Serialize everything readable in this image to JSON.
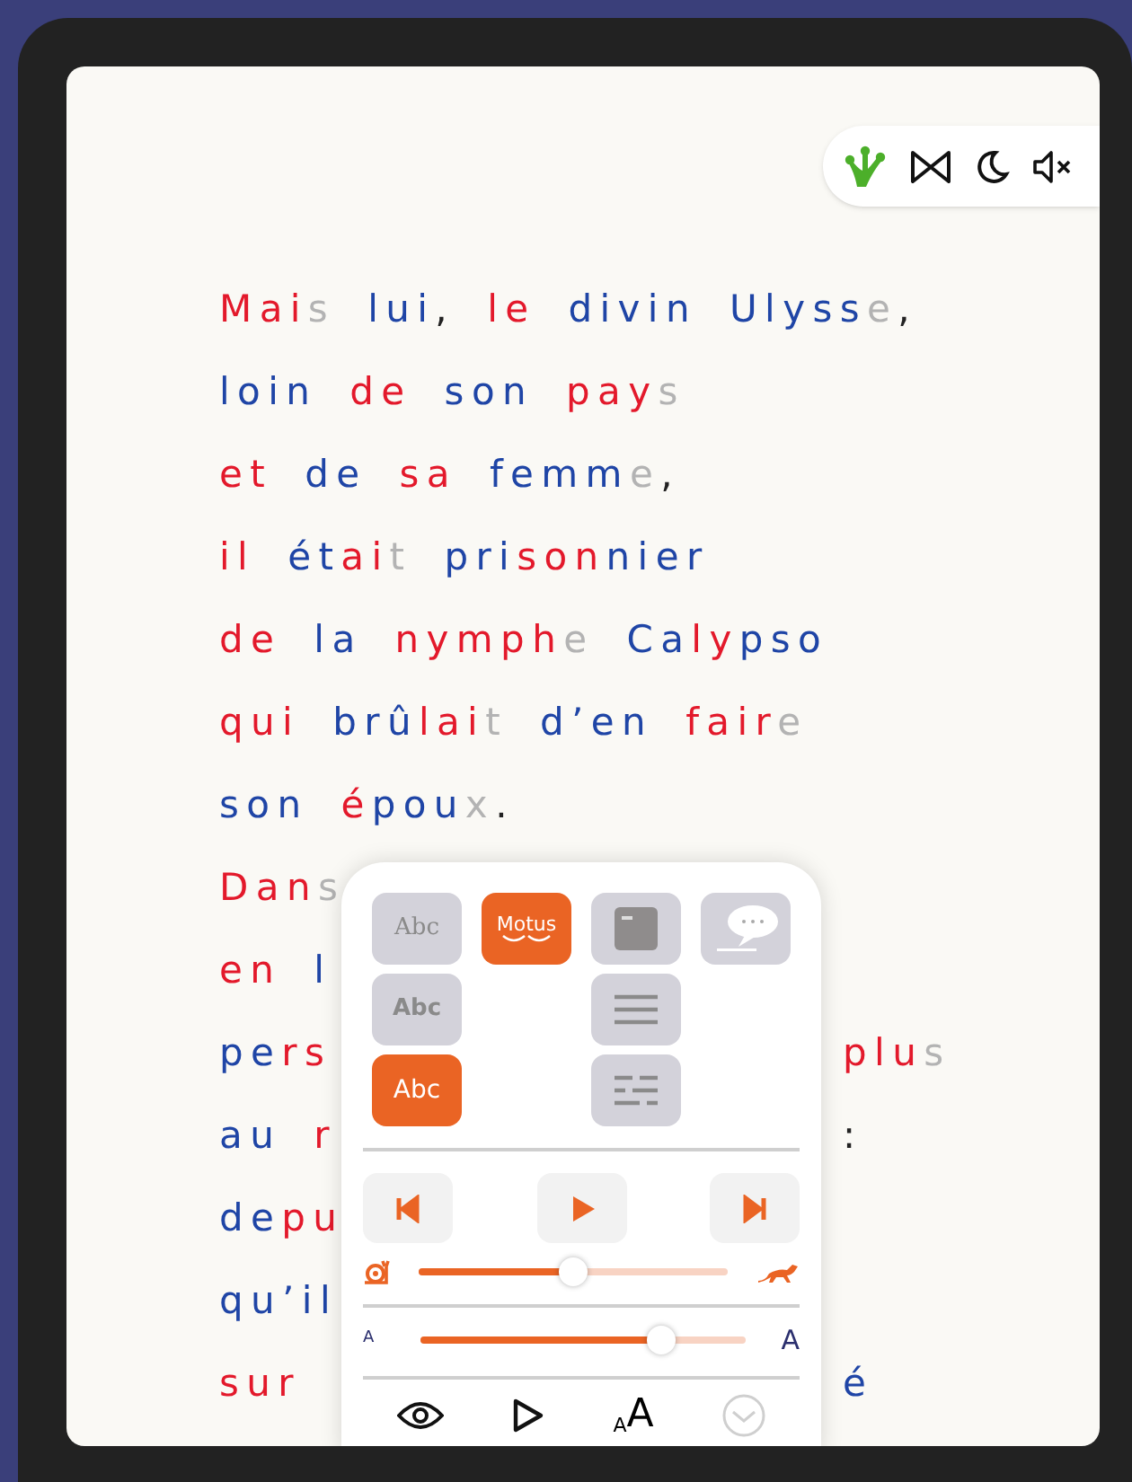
{
  "text_lines": [
    {
      "words": [
        [
          {
            "text": "Mai",
            "color": "#e3192b"
          },
          {
            "text": "s",
            "color": "#b3b3b3"
          }
        ],
        [
          {
            "text": "lui",
            "color": "#1f45a6"
          },
          {
            "text": ",",
            "color": "#222222"
          }
        ],
        [
          {
            "text": "le",
            "color": "#e3192b"
          }
        ],
        [
          {
            "text": "divin",
            "color": "#1f45a6"
          }
        ],
        [
          {
            "text": "Ulyss",
            "color": "#1f45a6"
          },
          {
            "text": "e",
            "color": "#b3b3b3"
          },
          {
            "text": ",",
            "color": "#222222"
          }
        ]
      ]
    },
    {
      "words": [
        [
          {
            "text": "loin",
            "color": "#1f45a6"
          }
        ],
        [
          {
            "text": "de",
            "color": "#e3192b"
          }
        ],
        [
          {
            "text": "son",
            "color": "#1f45a6"
          }
        ],
        [
          {
            "text": "pay",
            "color": "#e3192b"
          },
          {
            "text": "s",
            "color": "#b3b3b3"
          }
        ]
      ]
    },
    {
      "words": [
        [
          {
            "text": "et",
            "color": "#e3192b"
          }
        ],
        [
          {
            "text": "de",
            "color": "#1f45a6"
          }
        ],
        [
          {
            "text": "sa",
            "color": "#e3192b"
          }
        ],
        [
          {
            "text": "femm",
            "color": "#1f45a6"
          },
          {
            "text": "e",
            "color": "#b3b3b3"
          },
          {
            "text": ",",
            "color": "#222222"
          }
        ]
      ]
    },
    {
      "words": [
        [
          {
            "text": "il",
            "color": "#e3192b"
          }
        ],
        [
          {
            "text": "ét",
            "color": "#1f45a6"
          },
          {
            "text": "ai",
            "color": "#e3192b"
          },
          {
            "text": "t",
            "color": "#b3b3b3"
          }
        ],
        [
          {
            "text": "pri",
            "color": "#1f45a6"
          },
          {
            "text": "son",
            "color": "#e3192b"
          },
          {
            "text": "nier",
            "color": "#1f45a6"
          }
        ]
      ]
    },
    {
      "words": [
        [
          {
            "text": "de",
            "color": "#e3192b"
          }
        ],
        [
          {
            "text": "la",
            "color": "#1f45a6"
          }
        ],
        [
          {
            "text": "nymph",
            "color": "#e3192b"
          },
          {
            "text": "e",
            "color": "#b3b3b3"
          }
        ],
        [
          {
            "text": "Ca",
            "color": "#1f45a6"
          },
          {
            "text": "ly",
            "color": "#e3192b"
          },
          {
            "text": "pso",
            "color": "#1f45a6"
          }
        ]
      ]
    },
    {
      "words": [
        [
          {
            "text": "qui",
            "color": "#e3192b"
          }
        ],
        [
          {
            "text": "brû",
            "color": "#1f45a6"
          },
          {
            "text": "lai",
            "color": "#e3192b"
          },
          {
            "text": "t",
            "color": "#b3b3b3"
          }
        ],
        [
          {
            "text": "d’en",
            "color": "#1f45a6"
          }
        ],
        [
          {
            "text": "fair",
            "color": "#e3192b"
          },
          {
            "text": "e",
            "color": "#b3b3b3"
          }
        ]
      ]
    },
    {
      "words": [
        [
          {
            "text": "son",
            "color": "#1f45a6"
          }
        ],
        [
          {
            "text": "é",
            "color": "#e3192b"
          },
          {
            "text": "pou",
            "color": "#1f45a6"
          },
          {
            "text": "x",
            "color": "#b3b3b3"
          },
          {
            "text": ".",
            "color": "#222222"
          }
        ]
      ]
    },
    {
      "words": [
        [
          {
            "text": "Dan",
            "color": "#e3192b"
          },
          {
            "text": "s",
            "color": "#b3b3b3"
          }
        ]
      ]
    },
    {
      "words": [
        [
          {
            "text": "en",
            "color": "#e3192b"
          }
        ],
        [
          {
            "text": "l",
            "color": "#1f45a6"
          }
        ]
      ]
    },
    {
      "words": [
        [
          {
            "text": "pe",
            "color": "#1f45a6"
          },
          {
            "text": "rs",
            "color": "#e3192b"
          }
        ]
      ],
      "right_words": [
        [
          {
            "text": "plu",
            "color": "#e3192b"
          },
          {
            "text": "s",
            "color": "#b3b3b3"
          }
        ]
      ]
    },
    {
      "words": [
        [
          {
            "text": "au",
            "color": "#1f45a6"
          }
        ],
        [
          {
            "text": "r",
            "color": "#e3192b"
          }
        ]
      ],
      "right_words": [
        [
          {
            "text": ":",
            "color": "#222222"
          }
        ]
      ]
    },
    {
      "words": [
        [
          {
            "text": "de",
            "color": "#1f45a6"
          },
          {
            "text": "pu",
            "color": "#e3192b"
          }
        ]
      ]
    },
    {
      "words": [
        [
          {
            "text": "qu’il",
            "color": "#1f45a6"
          }
        ]
      ]
    },
    {
      "words": [
        [
          {
            "text": "sur",
            "color": "#e3192b"
          }
        ]
      ],
      "right_words": [
        [
          {
            "text": "é",
            "color": "#1f45a6"
          }
        ]
      ]
    }
  ],
  "panel": {
    "font_options": [
      {
        "label": "Abc",
        "kind": "serif",
        "selected": false
      },
      {
        "label": "Abc",
        "kind": "bold",
        "selected": false
      },
      {
        "label": "Abc",
        "kind": "sans",
        "selected": true
      }
    ],
    "motus": {
      "label": "Motus",
      "selected": true
    },
    "layout_options": [
      {
        "kind": "window",
        "selected": false
      },
      {
        "kind": "speech",
        "selected": false
      },
      {
        "kind": "lines",
        "selected": false
      },
      {
        "kind": "dashed",
        "selected": false
      }
    ],
    "speed": {
      "level": 0.5
    },
    "size": {
      "small_label": "A",
      "large_label": "A",
      "level": 0.74
    },
    "tabs": [
      {
        "kind": "eye"
      },
      {
        "kind": "play"
      },
      {
        "kind": "text-size",
        "small": "A",
        "large": "A"
      },
      {
        "kind": "collapse",
        "disabled": true
      }
    ]
  }
}
